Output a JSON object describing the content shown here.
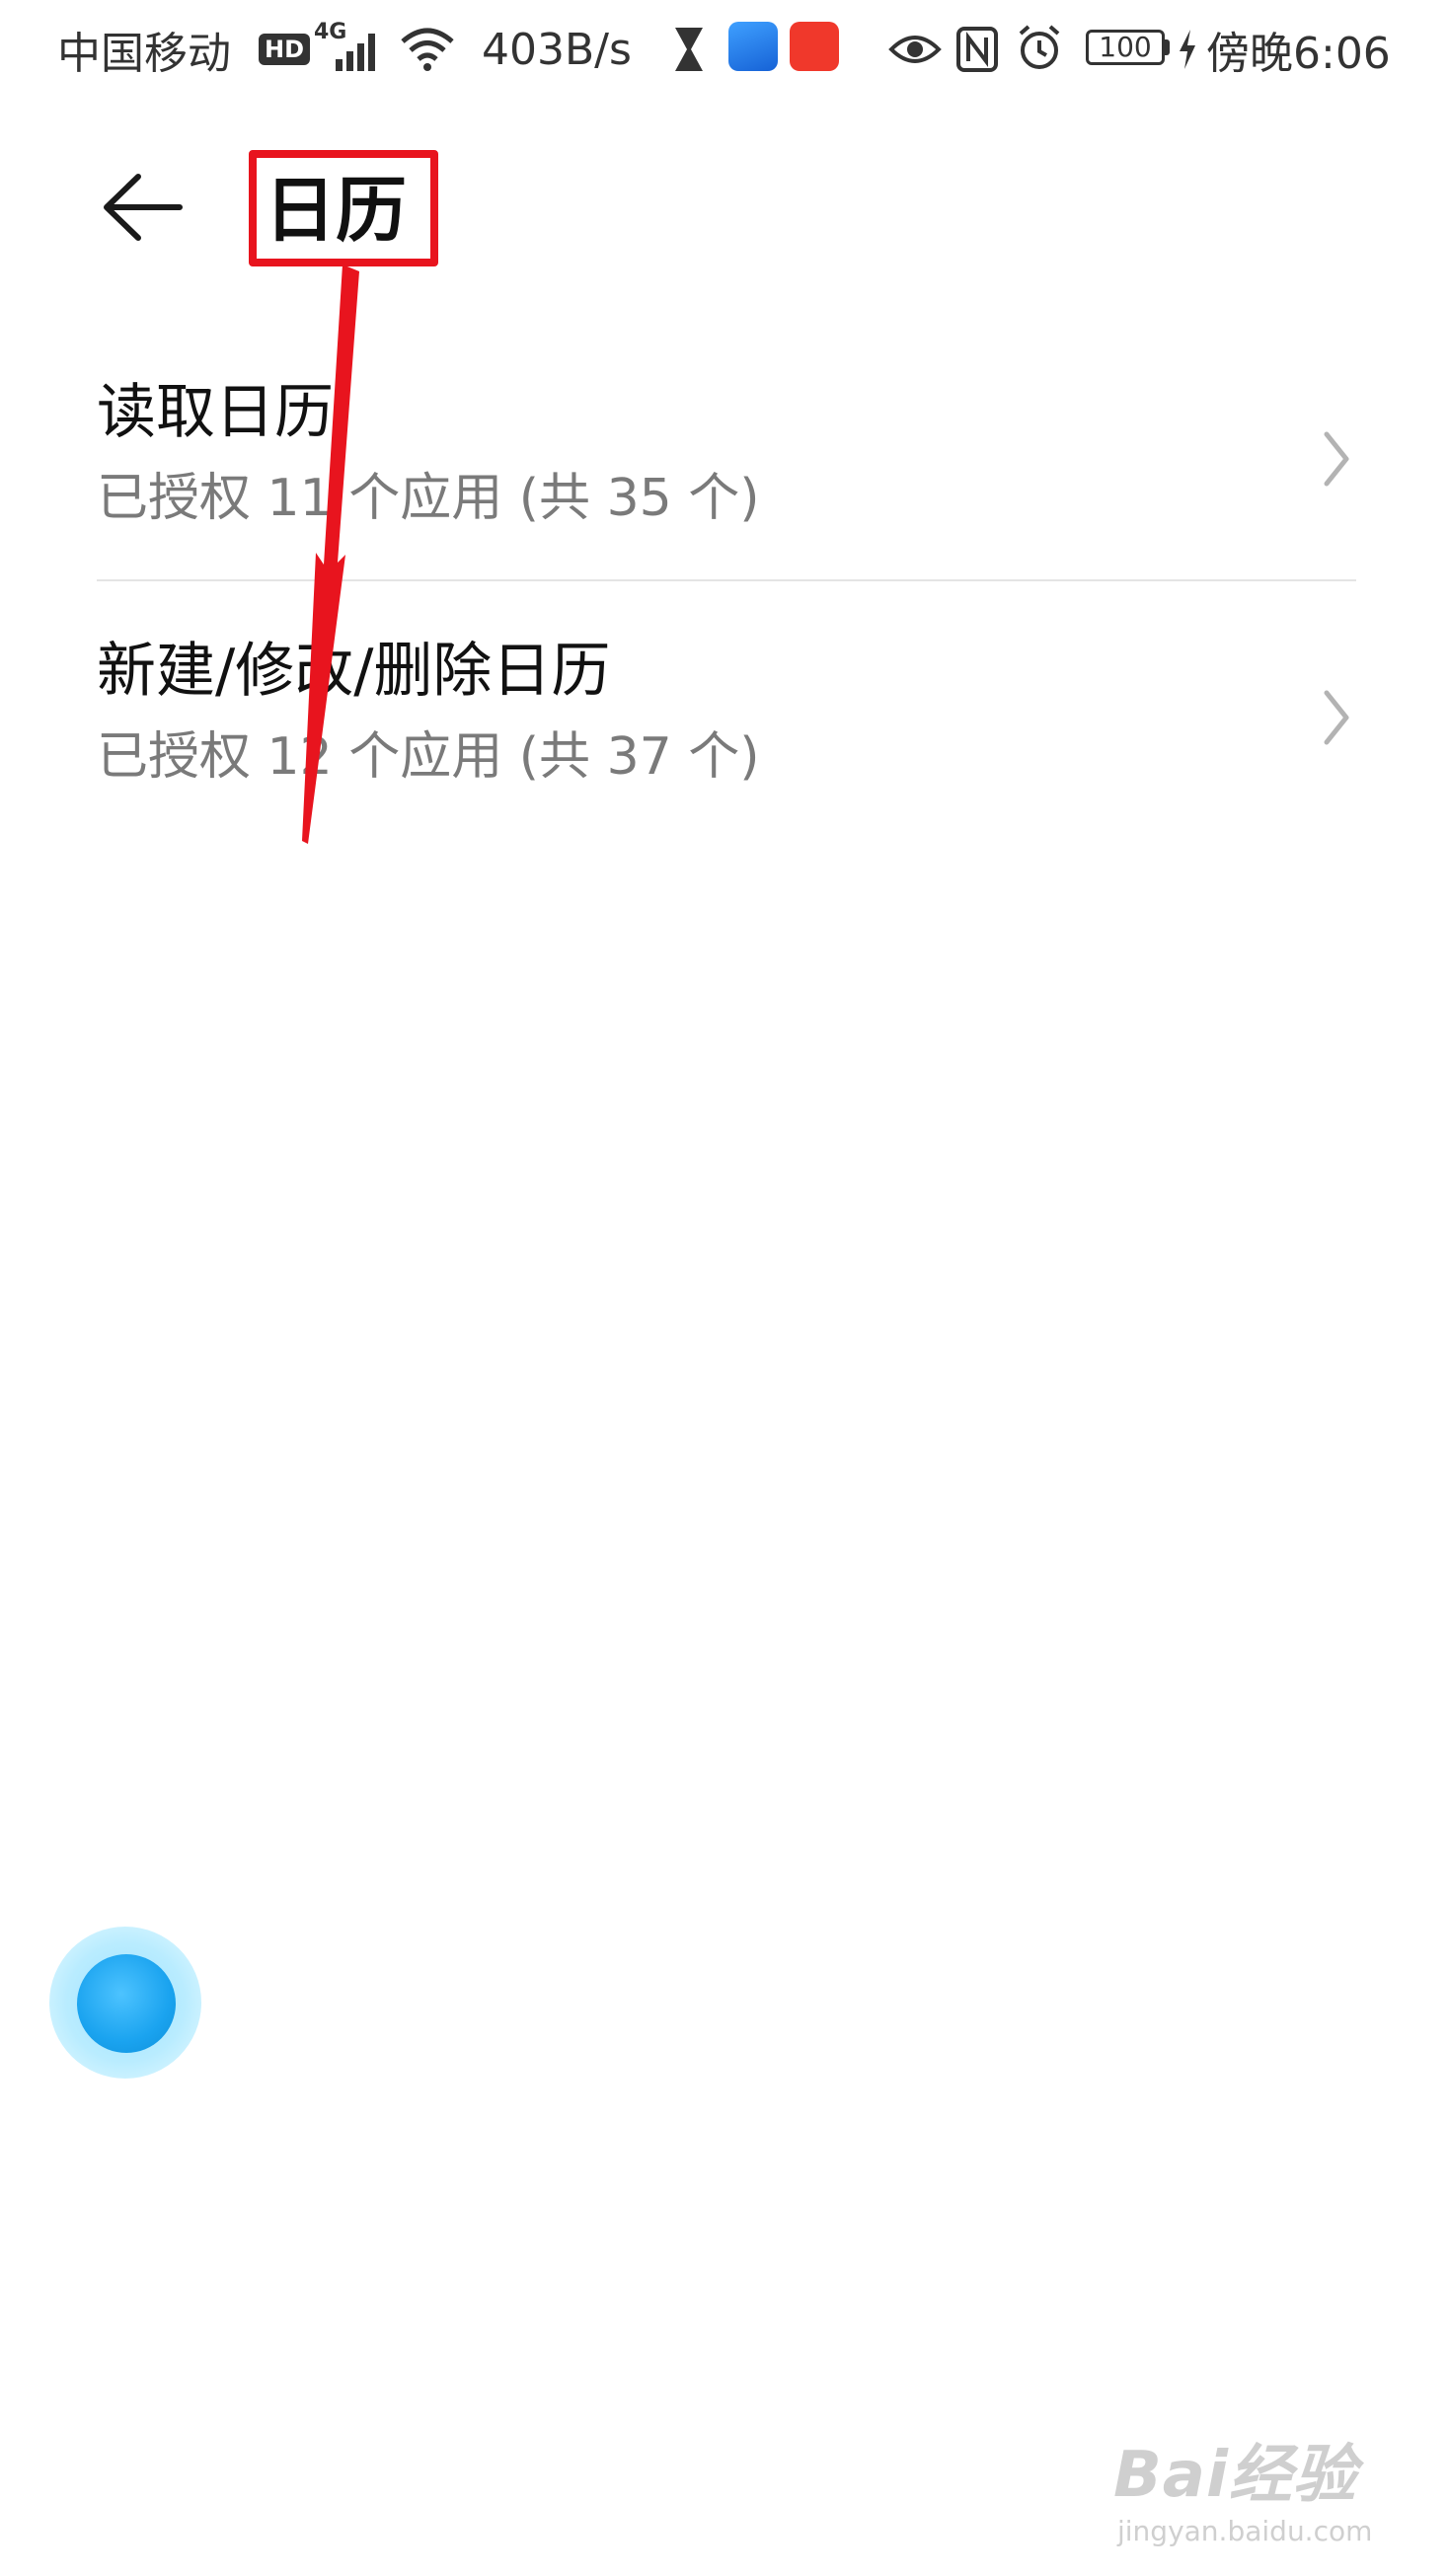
{
  "status_bar": {
    "carrier": "中国移动",
    "hd_badge": "HD",
    "network_type": "4G",
    "speed": "403B/s",
    "battery": "100",
    "time": "傍晚6:06"
  },
  "header": {
    "title": "日历"
  },
  "list": {
    "items": [
      {
        "title": "读取日历",
        "subtitle": "已授权 11 个应用 (共 35 个)"
      },
      {
        "title": "新建/修改/删除日历",
        "subtitle": "已授权 12 个应用 (共 37 个)"
      }
    ]
  },
  "watermark": {
    "brand": "Bai经验",
    "url": "jingyan.baidu.com"
  },
  "colors": {
    "annotation": "#e8141e",
    "float_ball": "#1aa3ef",
    "subtitle": "#7a7a7a"
  }
}
